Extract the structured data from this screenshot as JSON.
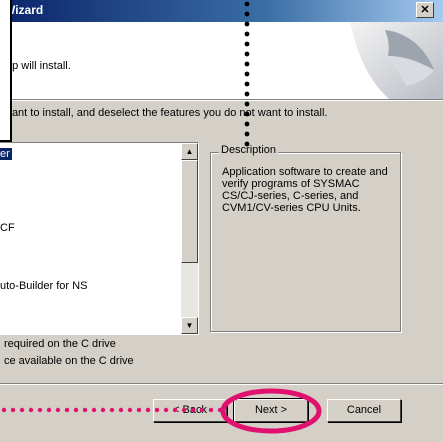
{
  "window": {
    "title": "Wizard",
    "close_glyph": "✕"
  },
  "header": {
    "subtitle": "up will install."
  },
  "instructions": "want to install, and deselect the features you do not want to install.",
  "features": {
    "items": [
      {
        "label": "er",
        "selected": true
      },
      {
        "label": "CF",
        "selected": false
      },
      {
        "label": "uto-Builder for NS",
        "selected": false
      }
    ],
    "scroll_up_glyph": "▲",
    "scroll_down_glyph": "▼"
  },
  "description": {
    "legend": "Description",
    "text": "Application software to create and verify programs of SYSMAC CS/CJ-series, C-series, and CVM1/CV-series CPU Units."
  },
  "disk_space": {
    "required": "required on the C drive",
    "available": "ce available on the C drive"
  },
  "buttons": {
    "back": "< Back",
    "next": "Next >",
    "cancel": "Cancel"
  },
  "annotation": {
    "highlight_color": "#e0116f",
    "dotted_color_magenta": "#e0116f",
    "dotted_color_black": "#000000"
  }
}
